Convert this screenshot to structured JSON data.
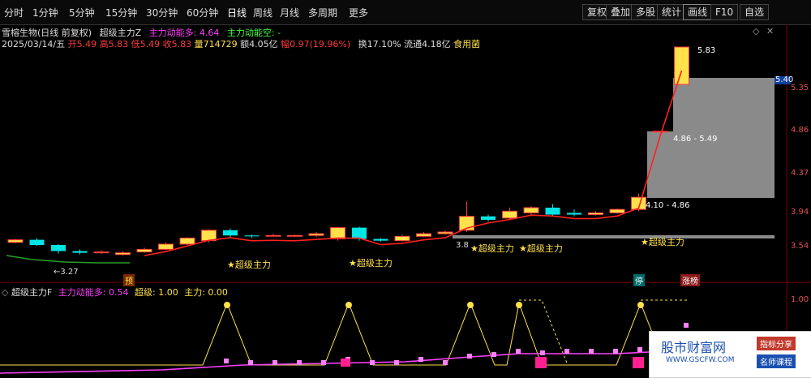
{
  "toolbar": {
    "periods": [
      "分时",
      "1分钟",
      "5分钟",
      "15分钟",
      "30分钟",
      "60分钟",
      "日线",
      "周线",
      "月线",
      "多周期",
      "更多"
    ],
    "active_period": "日线",
    "buttons": [
      "复权",
      "叠加",
      "多股",
      "统计",
      "画线",
      "F10",
      "自选"
    ]
  },
  "header": {
    "stock": "雪榕生物(日线 前复权)",
    "indicator": "超级主力Z",
    "bull_label": "主力动能多: 4.64",
    "bear_label": "主力动能空: -",
    "date": "2025/03/14/五",
    "open": "开5.49",
    "high": "高5.83",
    "low": "低5.49",
    "close": "收5.83",
    "volume": "量714729",
    "amount": "额4.05亿",
    "change": "幅0.97(19.96%)",
    "turnover": "换17.10%",
    "float": "流通4.18亿",
    "sector": "食用菌"
  },
  "price_axis": [
    "5.35",
    "4.86",
    "4.37",
    "3.94",
    "3.54"
  ],
  "current_price_tag": "5.40",
  "annotations": {
    "high_price": "5.83",
    "zone_upper": "4.86 - 5.49",
    "zone_lower": "4.10 - 4.86",
    "low_price": "3.27",
    "mid_price": "3.8",
    "signal": "超级主力",
    "tag_yu": "预",
    "tag_ting": "停",
    "tag_zhangbang": "涨榜"
  },
  "sub_header": {
    "name": "超级主力F",
    "bull": "主力动能多: 0.54",
    "super": "超级: 1.00",
    "main": "主力: 0.00",
    "axis_top": "1.00"
  },
  "watermark": {
    "title": "股市财富网",
    "url": "WWW.GSCFW.COM",
    "btn1": "指标分享",
    "btn2": "名师课程"
  },
  "colors": {
    "up": "#ff3b3b",
    "down": "#00e5e5",
    "signal": "#ffe14a",
    "ma": "#ff2020",
    "magenta": "#ff40ff"
  },
  "chart_data": {
    "type": "candlestick",
    "series": [
      {
        "name": "candles",
        "values": [
          [
            3.58,
            3.61,
            3.57,
            3.62
          ],
          [
            3.61,
            3.55,
            3.54,
            3.63
          ],
          [
            3.55,
            3.48,
            3.45,
            3.56
          ],
          [
            3.48,
            3.46,
            3.44,
            3.5
          ],
          [
            3.46,
            3.47,
            3.45,
            3.49
          ],
          [
            3.44,
            3.46,
            3.43,
            3.48
          ],
          [
            3.47,
            3.5,
            3.46,
            3.52
          ],
          [
            3.5,
            3.56,
            3.49,
            3.58
          ],
          [
            3.56,
            3.63,
            3.55,
            3.64
          ],
          [
            3.6,
            3.72,
            3.58,
            3.73
          ],
          [
            3.72,
            3.66,
            3.64,
            3.74
          ],
          [
            3.66,
            3.65,
            3.63,
            3.67
          ],
          [
            3.66,
            3.66,
            3.65,
            3.68
          ],
          [
            3.65,
            3.66,
            3.64,
            3.67
          ],
          [
            3.66,
            3.68,
            3.64,
            3.7
          ],
          [
            3.62,
            3.75,
            3.6,
            3.76
          ],
          [
            3.75,
            3.62,
            3.6,
            3.76
          ],
          [
            3.62,
            3.6,
            3.59,
            3.63
          ],
          [
            3.6,
            3.65,
            3.59,
            3.67
          ],
          [
            3.65,
            3.68,
            3.64,
            3.7
          ],
          [
            3.68,
            3.7,
            3.67,
            3.72
          ],
          [
            3.72,
            3.88,
            3.7,
            4.05
          ],
          [
            3.88,
            3.84,
            3.82,
            3.9
          ],
          [
            3.86,
            3.94,
            3.84,
            3.98
          ],
          [
            3.92,
            3.98,
            3.9,
            4.0
          ],
          [
            3.98,
            3.9,
            3.88,
            4.02
          ],
          [
            3.92,
            3.9,
            3.88,
            3.96
          ],
          [
            3.9,
            3.92,
            3.89,
            3.94
          ],
          [
            3.92,
            3.96,
            3.91,
            3.97
          ],
          [
            3.96,
            4.1,
            3.94,
            4.14
          ],
          [
            4.86,
            4.86,
            4.86,
            4.86
          ],
          [
            5.4,
            5.83,
            5.4,
            5.83
          ]
        ]
      }
    ],
    "price_range": [
      3.27,
      5.83
    ]
  }
}
